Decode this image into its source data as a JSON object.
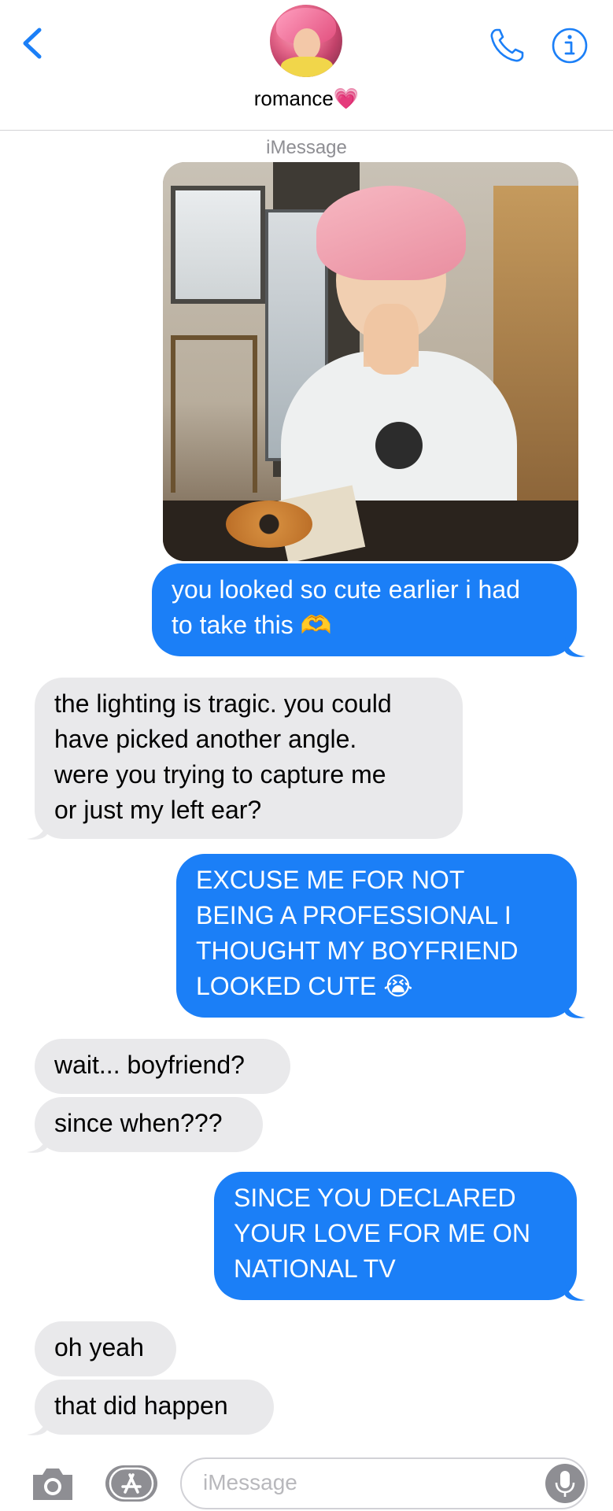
{
  "header": {
    "back_icon": "chevron-left-icon",
    "contact_name": "romance💗",
    "call_icon": "phone-icon",
    "info_icon": "info-icon",
    "accent_color": "#1b7ff7"
  },
  "conversation": {
    "service_label": "iMessage",
    "messages": [
      {
        "from": "me",
        "type": "image",
        "description_icon": "photo"
      },
      {
        "from": "me",
        "lines": [
          "you looked so cute earlier i had",
          "to take this 🫶"
        ]
      },
      {
        "from": "them",
        "lines": [
          "the lighting is tragic. you could",
          "have picked another angle.",
          "were you trying to capture me",
          "or just my left ear?"
        ]
      },
      {
        "from": "me",
        "lines": [
          "EXCUSE ME FOR NOT",
          "BEING A PROFESSIONAL I",
          "THOUGHT MY BOYFRIEND",
          "LOOKED CUTE 😭"
        ]
      },
      {
        "from": "them",
        "lines": [
          "wait... boyfriend?"
        ]
      },
      {
        "from": "them",
        "lines": [
          "since when???"
        ]
      },
      {
        "from": "me",
        "lines": [
          "SINCE YOU DECLARED",
          "YOUR LOVE FOR ME ON",
          "NATIONAL TV"
        ]
      },
      {
        "from": "them",
        "lines": [
          "oh yeah"
        ]
      },
      {
        "from": "them",
        "lines": [
          "that did happen"
        ]
      }
    ]
  },
  "input_bar": {
    "camera_icon": "camera-icon",
    "apps_icon": "app-store-icon",
    "placeholder": "iMessage",
    "mic_icon": "microphone-icon"
  }
}
